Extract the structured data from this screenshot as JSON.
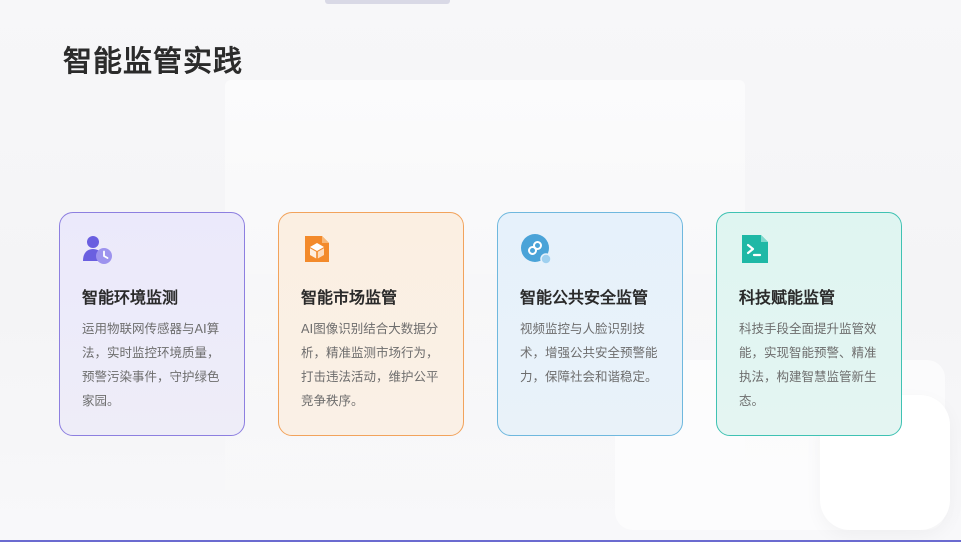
{
  "page": {
    "title": "智能监管实践"
  },
  "cards": [
    {
      "icon": "user-clock-icon",
      "accent": "#6a5fe0",
      "title": "智能环境监测",
      "description": "运用物联网传感器与AI算法，实时监控环境质量，预警污染事件，守护绿色家园。"
    },
    {
      "icon": "package-icon",
      "accent": "#f38a2b",
      "title": "智能市场监管",
      "description": "AI图像识别结合大数据分析，精准监测市场行为，打击违法活动，维护公平竞争秩序。"
    },
    {
      "icon": "link-icon",
      "accent": "#4aa3d8",
      "title": "智能公共安全监管",
      "description": "视频监控与人脸识别技术，增强公共安全预警能力，保障社会和谐稳定。"
    },
    {
      "icon": "terminal-file-icon",
      "accent": "#1fb8a6",
      "title": "科技赋能监管",
      "description": "科技手段全面提升监管效能，实现智能预警、精准执法，构建智慧监管新生态。"
    }
  ]
}
